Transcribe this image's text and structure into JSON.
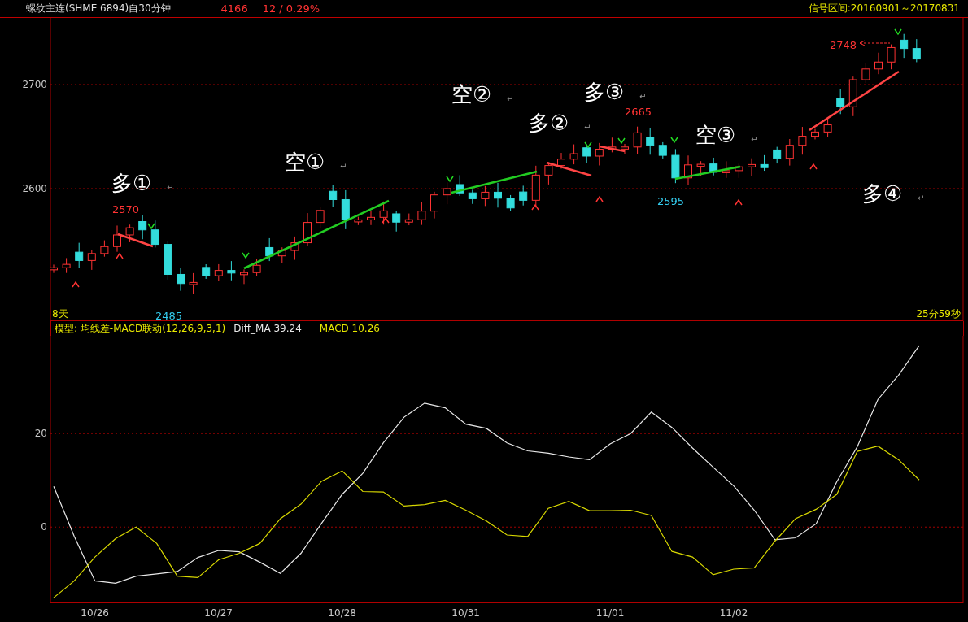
{
  "header": {
    "title": "螺纹主连(SHME 6894)自30分钟",
    "price": "4166",
    "change": "12 / 0.29%",
    "signal_range": "信号区间:20160901～20170831"
  },
  "price_chart": {
    "yticks": [
      "2700",
      "2600"
    ],
    "labels": [
      {
        "text": "多①",
        "mark": "↵"
      },
      {
        "text": "空①",
        "mark": "↵"
      },
      {
        "text": "空②",
        "mark": "↵"
      },
      {
        "text": "多②",
        "mark": "↵"
      },
      {
        "text": "多③",
        "mark": "↵"
      },
      {
        "text": "空③",
        "mark": "↵"
      },
      {
        "text": "多④",
        "mark": "↵"
      }
    ],
    "price_labels": [
      {
        "text": "2570",
        "color": "#ff3333"
      },
      {
        "text": "2485",
        "color": "#33ccee"
      },
      {
        "text": "2665",
        "color": "#ff3333"
      },
      {
        "text": "2595",
        "color": "#33ccee"
      },
      {
        "text": "2748",
        "color": "#ff3333"
      }
    ],
    "period": "8天",
    "countdown": "25分59秒"
  },
  "indicator": {
    "model": "模型: 均线差-MACD联动(12,26,9,3,1)",
    "diff_ma": "39.24",
    "macd": "10.26",
    "chart_data": {
      "type": "line",
      "categories": [
        null,
        null,
        "10/26",
        null,
        null,
        null,
        null,
        null,
        "10/27",
        null,
        null,
        null,
        null,
        null,
        "10/28",
        null,
        null,
        null,
        null,
        null,
        "10/31",
        null,
        null,
        null,
        null,
        null,
        null,
        "11/01",
        null,
        null,
        null,
        null,
        null,
        "11/02",
        null,
        null,
        null,
        null,
        null,
        null,
        null,
        null,
        null
      ],
      "series": [
        {
          "name": "Diff_MA",
          "color": "#e8e8e8",
          "values": [
            8.7,
            -2,
            -11.5,
            -12,
            -10.5,
            -10,
            -9.5,
            -6.5,
            -5,
            -5.3,
            -7.5,
            -9.9,
            -5.6,
            0.8,
            7,
            11.5,
            18,
            23.5,
            26.5,
            25.5,
            22,
            21.1,
            18,
            16.3,
            15.8,
            15,
            14.4,
            17.8,
            20,
            24.6,
            21.3,
            16.9,
            12.8,
            8.8,
            3.6,
            -2.7,
            -2.3,
            0.7,
            9.7,
            17.2,
            27.3,
            32.5,
            38.8
          ]
        },
        {
          "name": "MACD",
          "color": "#d8d800",
          "values": [
            -15.1,
            -11.5,
            -6.4,
            -2.5,
            0,
            -3.5,
            -10.5,
            -10.8,
            -7,
            -5.6,
            -3.5,
            1.8,
            4.9,
            9.8,
            12,
            7.6,
            7.5,
            4.5,
            4.8,
            5.7,
            3.6,
            1.3,
            -1.7,
            -2,
            4,
            5.5,
            3.5,
            3.5,
            3.6,
            2.5,
            -5.2,
            -6.4,
            -10.2,
            -9,
            -8.7,
            -3,
            1.8,
            3.8,
            7,
            16.2,
            17.3,
            14.4,
            10.1
          ]
        }
      ],
      "ylim": [
        -16.3,
        40.9
      ],
      "yticks": [
        {
          "value": 0,
          "label": "0"
        },
        {
          "value": 20,
          "label": "20"
        }
      ]
    }
  }
}
